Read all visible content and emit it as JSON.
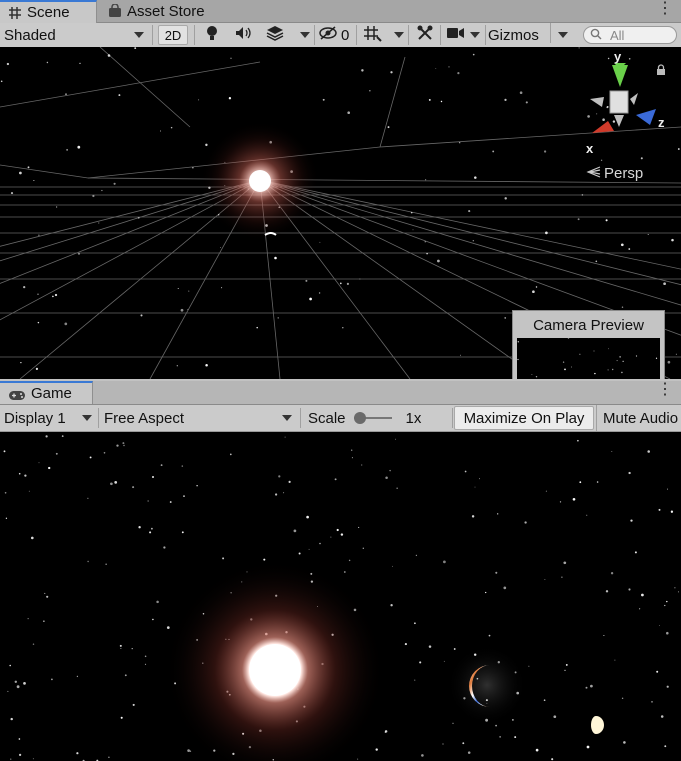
{
  "scene_tabs": [
    {
      "label": "Scene",
      "icon": "scene-grid-icon"
    },
    {
      "label": "Asset Store",
      "icon": "shopping-bag-icon"
    }
  ],
  "scene_toolbar": {
    "draw_mode": "Shaded",
    "toggle_2d": "2D",
    "hidden_count": "0",
    "gizmos": "Gizmos",
    "search_placeholder": "All"
  },
  "gizmo": {
    "y": "y",
    "x": "x",
    "z": "z",
    "projection": "Persp"
  },
  "camera_preview": {
    "title": "Camera Preview"
  },
  "game_tab": {
    "label": "Game",
    "icon": "gamepad-icon"
  },
  "game_toolbar": {
    "display": "Display 1",
    "aspect": "Free Aspect",
    "scale_label": "Scale",
    "scale_value": "1x",
    "maximize": "Maximize On Play",
    "mute": "Mute Audio"
  },
  "colors": {
    "tab_accent": "#3a79d4",
    "sun_glow": "#ff7a6a",
    "axis_y": "#6ad04a",
    "axis_x": "#d03a2a",
    "axis_z": "#3a6ad8"
  }
}
